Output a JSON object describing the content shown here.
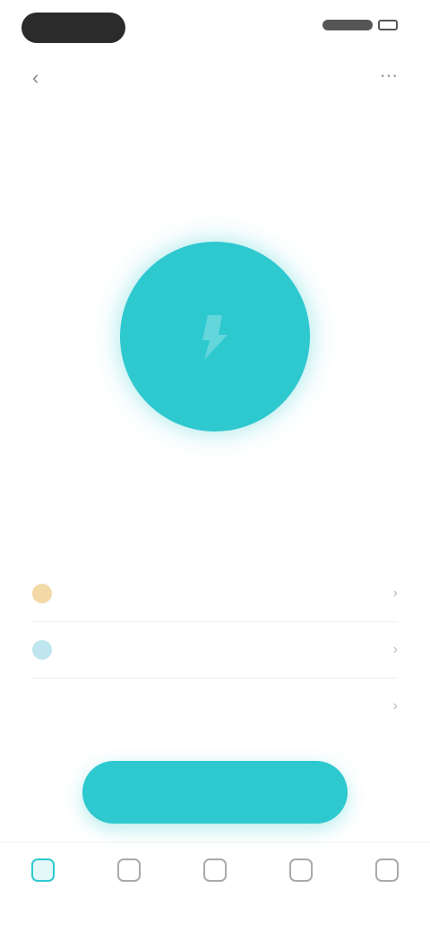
{
  "status_bar": {
    "time": "",
    "signal": "",
    "battery": ""
  },
  "header": {
    "title": "",
    "back_icon": "back-arrow-icon",
    "more_icon": "more-icon"
  },
  "tabs": [
    {
      "label": ""
    },
    {
      "label": ""
    },
    {
      "label": ""
    }
  ],
  "main": {
    "circle_color": "#2ec8cf",
    "circle_icon": "power-icon",
    "status_label": ""
  },
  "rows": [
    {
      "label": "",
      "value": "",
      "icon_color": "#f3d9a6"
    },
    {
      "label": "",
      "value": "",
      "icon_color": "#bfe6ef"
    },
    {
      "label": "",
      "value": "",
      "icon_color": "#ffffff"
    }
  ],
  "action_button": {
    "label": ""
  },
  "bottom_nav": [
    {
      "label": "",
      "active": true
    },
    {
      "label": "",
      "active": false
    },
    {
      "label": "",
      "active": false
    },
    {
      "label": "",
      "active": false
    },
    {
      "label": "",
      "active": false
    }
  ],
  "colors": {
    "accent": "#2ec8cf"
  }
}
